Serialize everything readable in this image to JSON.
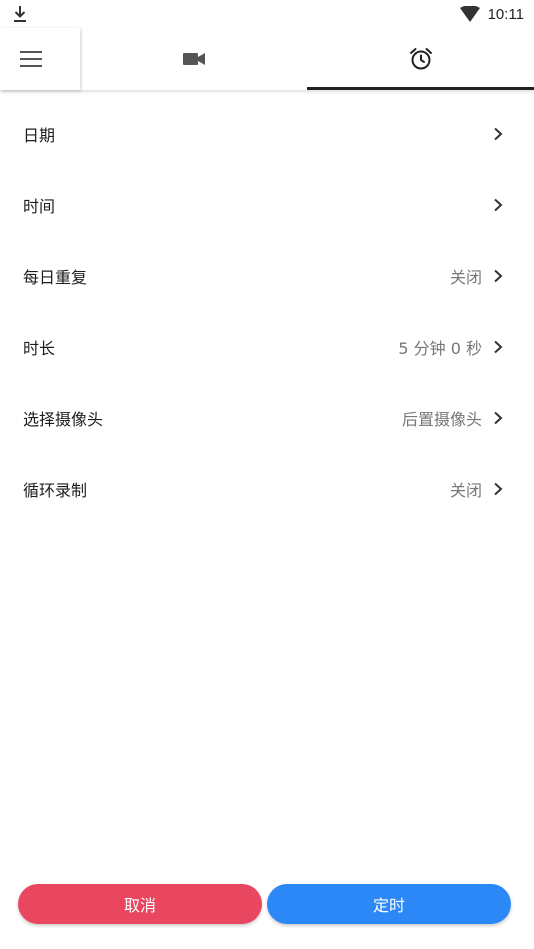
{
  "status_bar": {
    "time": "10:11",
    "left_icon": "download-icon",
    "right_icon": "wifi-icon"
  },
  "tabs": {
    "menu_icon": "menu-icon",
    "items": [
      {
        "icon": "video-camera-icon",
        "selected": false
      },
      {
        "icon": "alarm-clock-icon",
        "selected": true
      }
    ]
  },
  "settings": {
    "rows": [
      {
        "label": "日期",
        "value": ""
      },
      {
        "label": "时间",
        "value": ""
      },
      {
        "label": "每日重复",
        "value": "关闭"
      },
      {
        "label": "时长",
        "value": "5 分钟 0 秒"
      },
      {
        "label": "选择摄像头",
        "value": "后置摄像头"
      },
      {
        "label": "循环录制",
        "value": "关闭"
      }
    ]
  },
  "buttons": {
    "cancel_label": "取消",
    "confirm_label": "定时"
  },
  "colors": {
    "cancel": "#e8475f",
    "confirm": "#2b88f6",
    "indicator": "#222222"
  }
}
